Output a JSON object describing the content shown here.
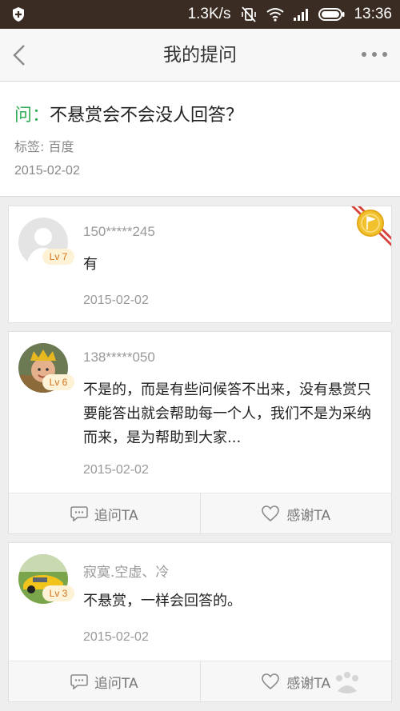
{
  "status_bar": {
    "speed": "1.3K/s",
    "time": "13:36"
  },
  "navbar": {
    "title": "我的提问"
  },
  "question": {
    "prefix": "问：",
    "text": "不悬赏会不会没人回答？",
    "tag": "标签: 百度",
    "date": "2015-02-02"
  },
  "answers": [
    {
      "level": "Lv 7",
      "username": "150*****245",
      "content": "有",
      "date": "2015-02-02",
      "best": true
    },
    {
      "level": "Lv 6",
      "username": "138*****050",
      "content": "不是的，而是有些问候答不出来，没有悬赏只要能答出就会帮助每一个人，我们不是为采纳而来，是为帮助到大家...",
      "date": "2015-02-02",
      "ask_label": "追问TA",
      "thank_label": "感谢TA"
    },
    {
      "level": "Lv 3",
      "username": "寂寞.空虚、冷",
      "content": "不悬赏，一样会回答的。",
      "date": "2015-02-02",
      "ask_label": "追问TA",
      "thank_label": "感谢TA"
    }
  ],
  "colors": {
    "status_bar_bg": "#3a2c23",
    "accent_green": "#2fae54",
    "level_text": "#d2741b",
    "ribbon_red": "#d8413a",
    "medal_gold": "#f2c12e"
  }
}
